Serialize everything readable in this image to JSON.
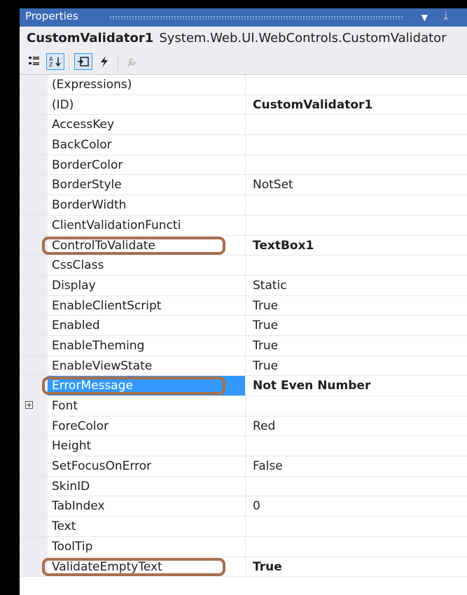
{
  "panel": {
    "title": "Properties"
  },
  "object": {
    "name": "CustomValidator1",
    "type": "System.Web.UI.WebControls.CustomValidator"
  },
  "toolbar": {
    "categorized_icon": "categorized-icon",
    "alphabetical_icon": "alphabetical-icon",
    "properties_icon": "properties-icon",
    "events_icon": "events-icon",
    "property_pages_icon": "wrench-icon"
  },
  "properties": [
    {
      "name": "(Expressions)",
      "value": ""
    },
    {
      "name": "(ID)",
      "value": "CustomValidator1",
      "bold": true
    },
    {
      "name": "AccessKey",
      "value": ""
    },
    {
      "name": "BackColor",
      "value": ""
    },
    {
      "name": "BorderColor",
      "value": ""
    },
    {
      "name": "BorderStyle",
      "value": "NotSet"
    },
    {
      "name": "BorderWidth",
      "value": ""
    },
    {
      "name": "ClientValidationFuncti",
      "value": ""
    },
    {
      "name": "ControlToValidate",
      "value": "TextBox1",
      "bold": true,
      "highlight": true
    },
    {
      "name": "CssClass",
      "value": ""
    },
    {
      "name": "Display",
      "value": "Static"
    },
    {
      "name": "EnableClientScript",
      "value": "True"
    },
    {
      "name": "Enabled",
      "value": "True"
    },
    {
      "name": "EnableTheming",
      "value": "True"
    },
    {
      "name": "EnableViewState",
      "value": "True"
    },
    {
      "name": "ErrorMessage",
      "value": "Not Even Number",
      "bold": true,
      "highlight": true,
      "selected": true
    },
    {
      "name": "Font",
      "value": "",
      "expandable": true
    },
    {
      "name": "ForeColor",
      "value": "Red"
    },
    {
      "name": "Height",
      "value": ""
    },
    {
      "name": "SetFocusOnError",
      "value": "False"
    },
    {
      "name": "SkinID",
      "value": ""
    },
    {
      "name": "TabIndex",
      "value": "0"
    },
    {
      "name": "Text",
      "value": ""
    },
    {
      "name": "ToolTip",
      "value": ""
    },
    {
      "name": "ValidateEmptyText",
      "value": "True",
      "bold": true,
      "highlight": true
    }
  ],
  "colors": {
    "title_bar": "#3c6ab5",
    "selection": "#3399ff",
    "highlight_outline": "#a76f4e"
  }
}
